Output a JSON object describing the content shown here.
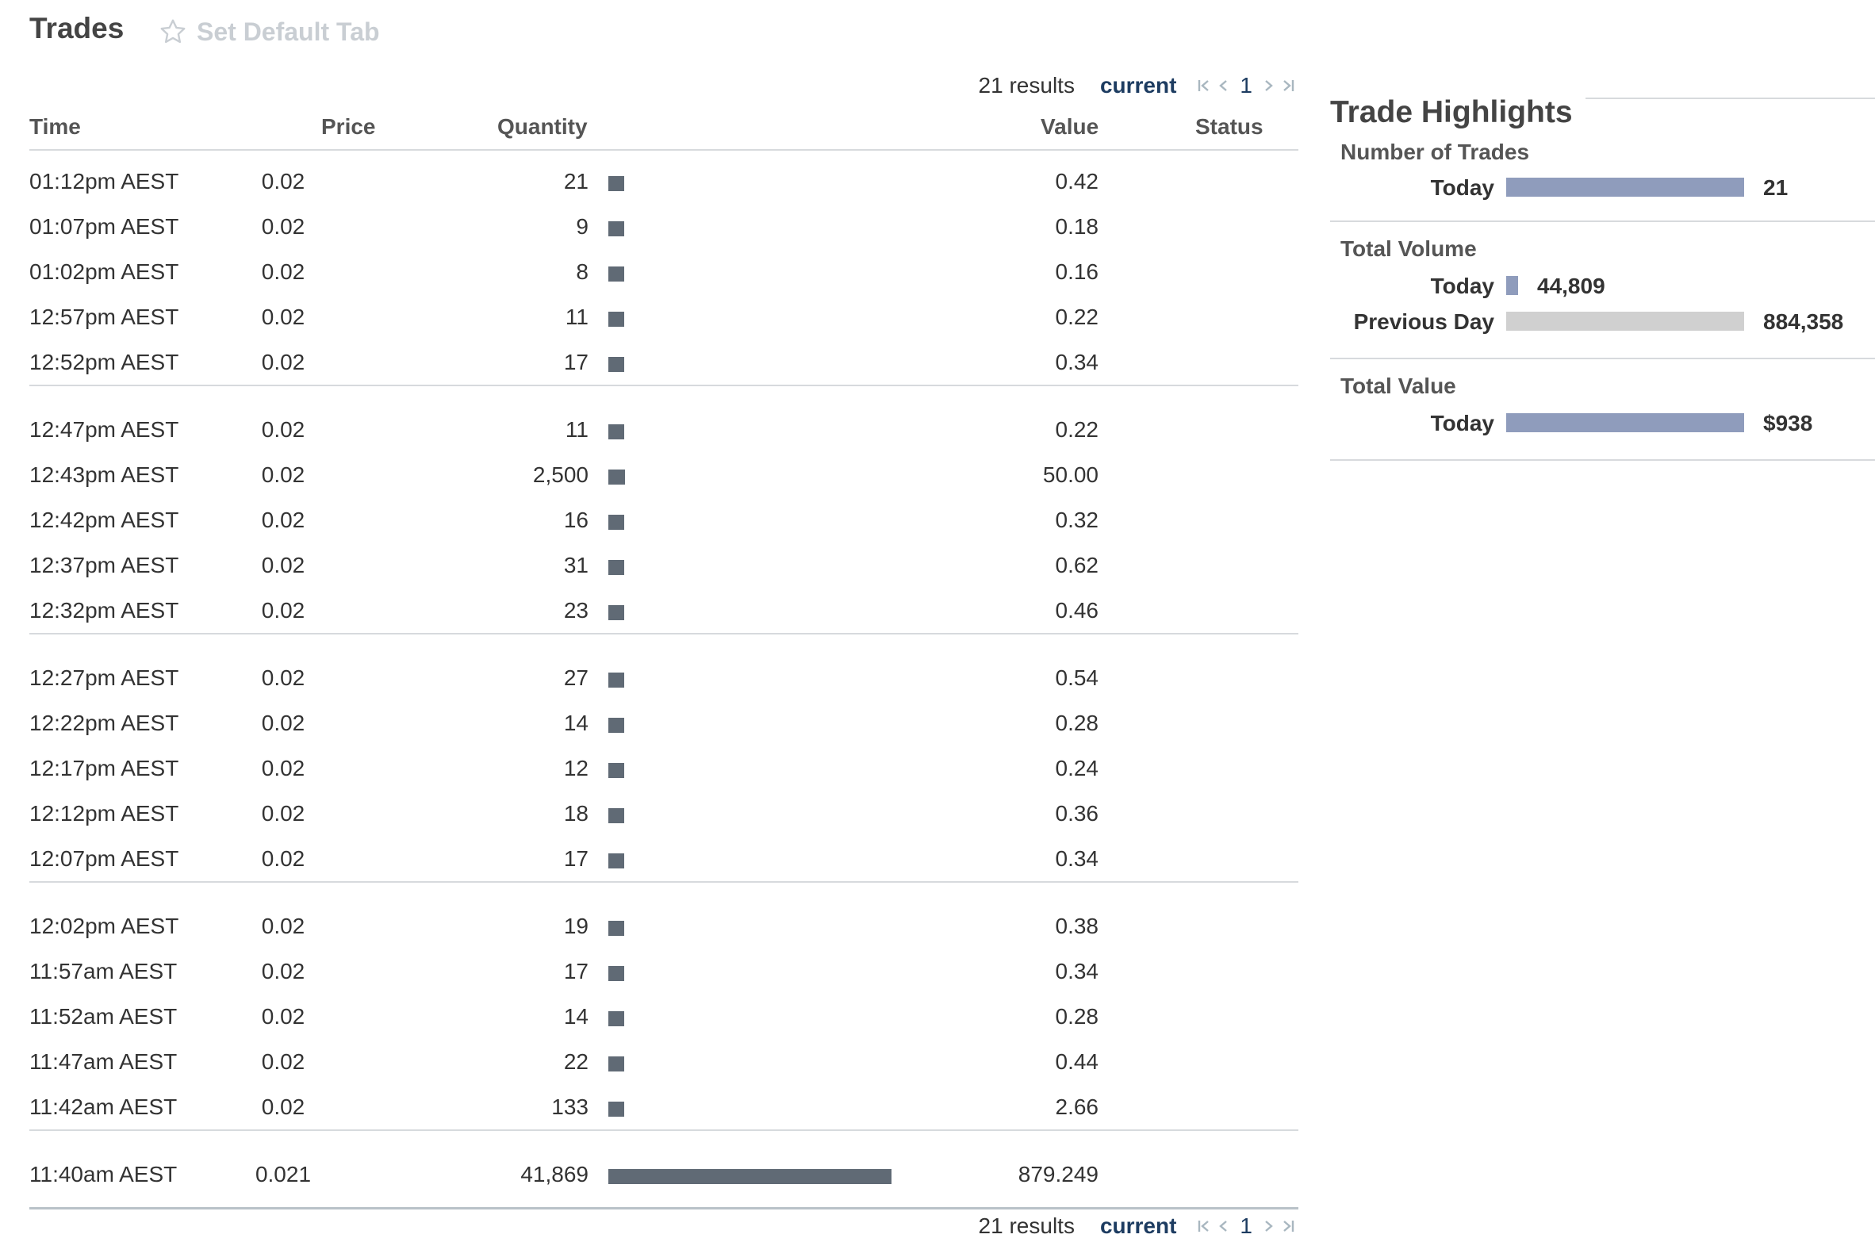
{
  "header": {
    "title": "Trades",
    "set_default_label": "Set Default Tab"
  },
  "pager": {
    "results": "21 results",
    "current": "current",
    "page": "1"
  },
  "table": {
    "columns": {
      "time": "Time",
      "price": "Price",
      "quantity": "Quantity",
      "value": "Value",
      "status": "Status"
    },
    "max_quantity": 41869,
    "groups": [
      [
        {
          "time": "01:12pm AEST",
          "price": "0.02",
          "quantity": "21",
          "qty_num": 21,
          "value": "0.42",
          "status": ""
        },
        {
          "time": "01:07pm AEST",
          "price": "0.02",
          "quantity": "9",
          "qty_num": 9,
          "value": "0.18",
          "status": ""
        },
        {
          "time": "01:02pm AEST",
          "price": "0.02",
          "quantity": "8",
          "qty_num": 8,
          "value": "0.16",
          "status": ""
        },
        {
          "time": "12:57pm AEST",
          "price": "0.02",
          "quantity": "11",
          "qty_num": 11,
          "value": "0.22",
          "status": ""
        },
        {
          "time": "12:52pm AEST",
          "price": "0.02",
          "quantity": "17",
          "qty_num": 17,
          "value": "0.34",
          "status": ""
        }
      ],
      [
        {
          "time": "12:47pm AEST",
          "price": "0.02",
          "quantity": "11",
          "qty_num": 11,
          "value": "0.22",
          "status": ""
        },
        {
          "time": "12:43pm AEST",
          "price": "0.02",
          "quantity": "2,500",
          "qty_num": 2500,
          "value": "50.00",
          "status": ""
        },
        {
          "time": "12:42pm AEST",
          "price": "0.02",
          "quantity": "16",
          "qty_num": 16,
          "value": "0.32",
          "status": ""
        },
        {
          "time": "12:37pm AEST",
          "price": "0.02",
          "quantity": "31",
          "qty_num": 31,
          "value": "0.62",
          "status": ""
        },
        {
          "time": "12:32pm AEST",
          "price": "0.02",
          "quantity": "23",
          "qty_num": 23,
          "value": "0.46",
          "status": ""
        }
      ],
      [
        {
          "time": "12:27pm AEST",
          "price": "0.02",
          "quantity": "27",
          "qty_num": 27,
          "value": "0.54",
          "status": ""
        },
        {
          "time": "12:22pm AEST",
          "price": "0.02",
          "quantity": "14",
          "qty_num": 14,
          "value": "0.28",
          "status": ""
        },
        {
          "time": "12:17pm AEST",
          "price": "0.02",
          "quantity": "12",
          "qty_num": 12,
          "value": "0.24",
          "status": ""
        },
        {
          "time": "12:12pm AEST",
          "price": "0.02",
          "quantity": "18",
          "qty_num": 18,
          "value": "0.36",
          "status": ""
        },
        {
          "time": "12:07pm AEST",
          "price": "0.02",
          "quantity": "17",
          "qty_num": 17,
          "value": "0.34",
          "status": ""
        }
      ],
      [
        {
          "time": "12:02pm AEST",
          "price": "0.02",
          "quantity": "19",
          "qty_num": 19,
          "value": "0.38",
          "status": ""
        },
        {
          "time": "11:57am AEST",
          "price": "0.02",
          "quantity": "17",
          "qty_num": 17,
          "value": "0.34",
          "status": ""
        },
        {
          "time": "11:52am AEST",
          "price": "0.02",
          "quantity": "14",
          "qty_num": 14,
          "value": "0.28",
          "status": ""
        },
        {
          "time": "11:47am AEST",
          "price": "0.02",
          "quantity": "22",
          "qty_num": 22,
          "value": "0.44",
          "status": ""
        },
        {
          "time": "11:42am AEST",
          "price": "0.02",
          "quantity": "133",
          "qty_num": 133,
          "value": "2.66",
          "status": ""
        }
      ],
      [
        {
          "time": "11:40am AEST",
          "price": "0.021",
          "quantity": "41,869",
          "qty_num": 41869,
          "value": "879.249",
          "status": ""
        }
      ]
    ]
  },
  "highlights": {
    "title": "Trade Highlights",
    "number_of_trades": {
      "title": "Number of Trades",
      "today_label": "Today",
      "today_value": "21",
      "today_fill": 1.0
    },
    "total_volume": {
      "title": "Total Volume",
      "today_label": "Today",
      "today_value": "44,809",
      "today_fill": 0.0507,
      "previous_label": "Previous Day",
      "previous_value": "884,358",
      "previous_fill": 1.0
    },
    "total_value": {
      "title": "Total Value",
      "today_label": "Today",
      "today_value": "$938",
      "today_fill": 1.0
    }
  },
  "colors": {
    "qty_bar": "#606a75",
    "highlight_bar": "#8f9cbc",
    "previous_bar": "#d0d0d0",
    "link": "#1d3c61",
    "muted": "#c9ced3"
  }
}
